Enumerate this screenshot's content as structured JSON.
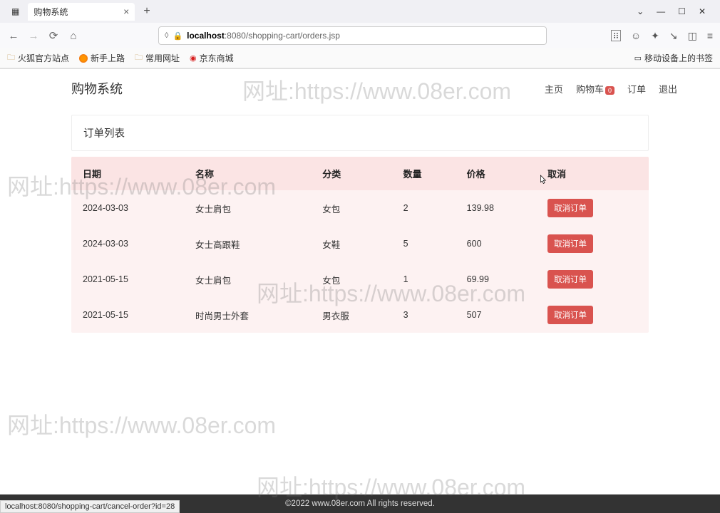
{
  "browser": {
    "tab_title": "购物系统",
    "url_host": "localhost",
    "url_path": ":8080/shopping-cart/orders.jsp",
    "bookmarks": {
      "b1": "火狐官方站点",
      "b2": "新手上路",
      "b3": "常用网址",
      "b4": "京东商城",
      "b5": "移动设备上的书签"
    },
    "status": "localhost:8080/shopping-cart/cancel-order?id=28"
  },
  "nav": {
    "brand": "购物系统",
    "home": "主页",
    "cart": "购物车",
    "cart_badge": "0",
    "orders": "订单",
    "logout": "退出"
  },
  "page": {
    "title": "订单列表",
    "columns": {
      "date": "日期",
      "name": "名称",
      "category": "分类",
      "qty": "数量",
      "price": "价格",
      "cancel": "取消"
    },
    "rows": [
      {
        "date": "2024-03-03",
        "name": "女士肩包",
        "category": "女包",
        "qty": "2",
        "price": "139.98",
        "btn": "取消订单"
      },
      {
        "date": "2024-03-03",
        "name": "女士高跟鞋",
        "category": "女鞋",
        "qty": "5",
        "price": "600",
        "btn": "取消订单"
      },
      {
        "date": "2021-05-15",
        "name": "女士肩包",
        "category": "女包",
        "qty": "1",
        "price": "69.99",
        "btn": "取消订单"
      },
      {
        "date": "2021-05-15",
        "name": "时尚男士外套",
        "category": "男衣服",
        "qty": "3",
        "price": "507",
        "btn": "取消订单"
      }
    ]
  },
  "footer": "©2022 www.08er.com All rights reserved.",
  "watermark": "网址:https://www.08er.com"
}
